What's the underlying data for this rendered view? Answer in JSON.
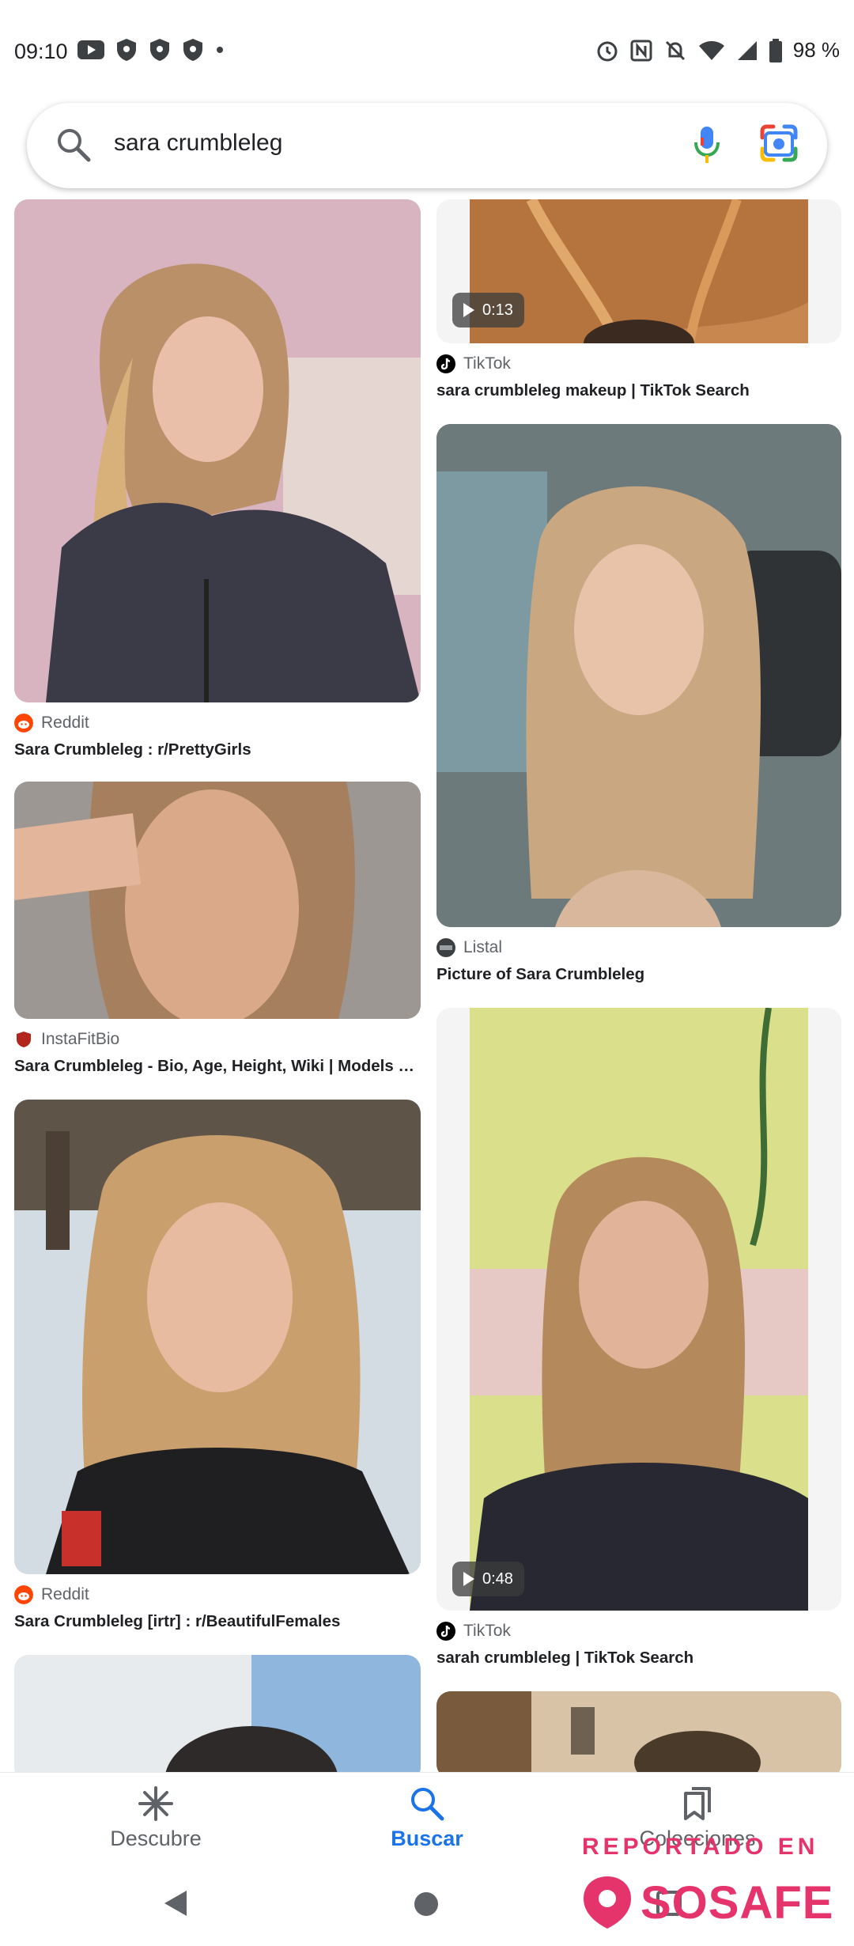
{
  "status_bar": {
    "time": "09:10",
    "battery": "98 %",
    "left_icons": [
      "youtube-icon",
      "shield-icon",
      "shield-icon",
      "shield-icon",
      "dot-icon"
    ],
    "right_icons": [
      "alarm-icon",
      "nfc-icon",
      "mute-icon",
      "wifi-icon",
      "signal-icon",
      "battery-icon"
    ]
  },
  "search": {
    "query": "sara crumbleleg"
  },
  "results": [
    {
      "source": "TikTok",
      "caption": "sara crumbleleg makeup | TikTok Search",
      "duration": "0:13",
      "type": "video"
    },
    {
      "source": "Reddit",
      "caption": "Sara Crumbleleg : r/PrettyGirls",
      "type": "image"
    },
    {
      "source": "Listal",
      "caption": "Picture of Sara Crumbleleg",
      "type": "image"
    },
    {
      "source": "InstaFitBio",
      "caption": "Sara Crumbleleg - Bio, Age, Height, Wiki | Models Bi...",
      "type": "image"
    },
    {
      "source": "Reddit",
      "caption": "Sara Crumbleleg [irtr] : r/BeautifulFemales",
      "type": "image"
    },
    {
      "source": "TikTok",
      "caption": "sarah crumbleleg | TikTok Search",
      "duration": "0:48",
      "type": "video"
    }
  ],
  "bottom_nav": {
    "items": [
      {
        "label": "Descubre",
        "icon": "asterisk-icon"
      },
      {
        "label": "Buscar",
        "icon": "search-icon",
        "active": true
      },
      {
        "label": "Colecciones",
        "icon": "bookmarks-icon"
      }
    ]
  },
  "watermark": {
    "line1": "REPORTADO EN",
    "brand": "SOSAFE"
  },
  "colors": {
    "accent": "#1a73e8",
    "watermark": "#e5336b"
  }
}
